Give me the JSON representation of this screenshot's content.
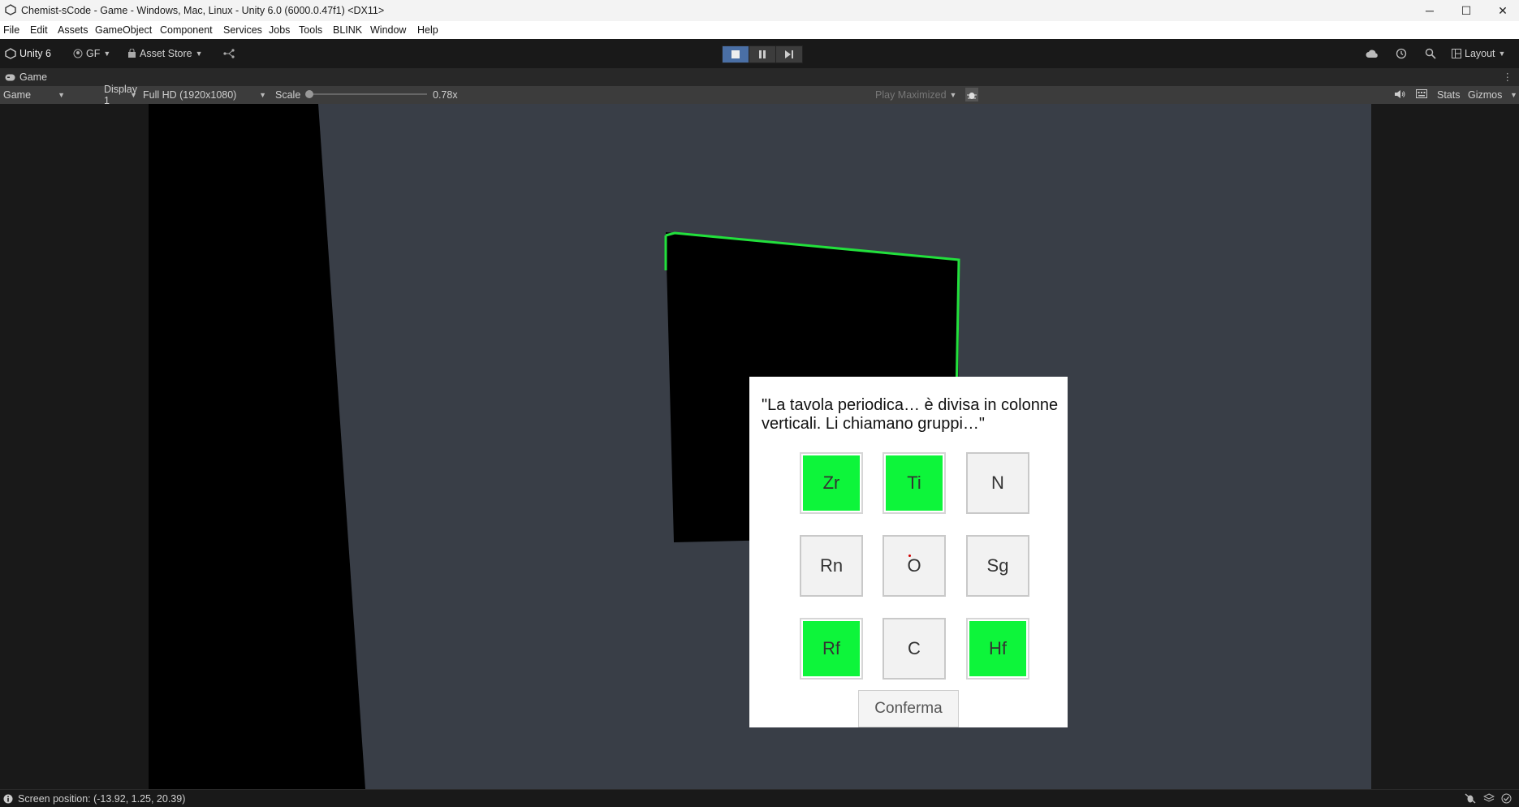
{
  "window": {
    "title": "Chemist-sCode - Game - Windows, Mac, Linux - Unity 6.0 (6000.0.47f1) <DX11>",
    "controls": [
      "─",
      "☐",
      "✕"
    ]
  },
  "menu": [
    "File",
    "Edit",
    "Assets",
    "GameObject",
    "Component",
    "Services",
    "Jobs",
    "Tools",
    "BLINK",
    "Window",
    "Help"
  ],
  "toolbar": {
    "unity_label": "Unity 6",
    "account": "GF",
    "asset_store": "Asset Store",
    "layout": "Layout"
  },
  "tab": {
    "label": "Game"
  },
  "gamebar": {
    "view": "Game",
    "display": "Display 1",
    "resolution": "Full HD (1920x1080)",
    "scale_label": "Scale",
    "scale_value": "0.78x",
    "play_mode": "Play Maximized",
    "stats": "Stats",
    "gizmos": "Gizmos"
  },
  "dialog": {
    "prompt": "\"La tavola periodica… è divisa in colonne verticali. Li chiamano gruppi…\"",
    "cells": [
      {
        "symbol": "Zr",
        "selected": true
      },
      {
        "symbol": "Ti",
        "selected": true
      },
      {
        "symbol": "N",
        "selected": false
      },
      {
        "symbol": "Rn",
        "selected": false
      },
      {
        "symbol": "O",
        "selected": false
      },
      {
        "symbol": "Sg",
        "selected": false
      },
      {
        "symbol": "Rf",
        "selected": true
      },
      {
        "symbol": "C",
        "selected": false
      },
      {
        "symbol": "Hf",
        "selected": true
      }
    ],
    "confirm_label": "Conferma"
  },
  "status": {
    "text": "Screen position: (-13.92, 1.25, 20.39)"
  },
  "colors": {
    "selected": "#0df53a",
    "scene_bg": "#393e47",
    "play_active": "#4a6fa5",
    "outline": "#22e03c"
  }
}
